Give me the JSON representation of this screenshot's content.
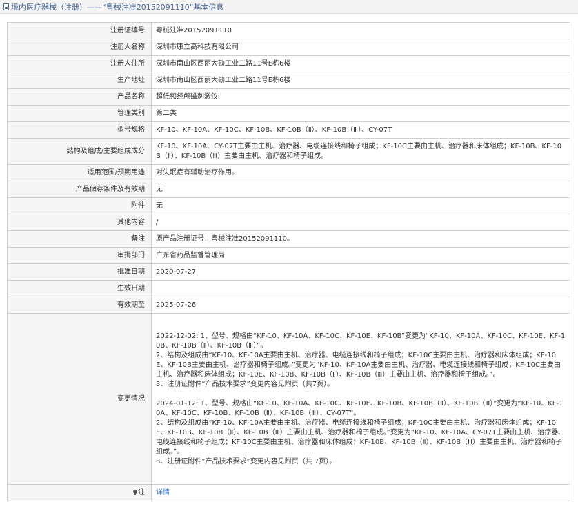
{
  "page": {
    "title": "境内医疗器械（注册）——“粤械注准20152091110”基本信息"
  },
  "rows": [
    {
      "label": "注册证编号",
      "value": "粤械注准20152091110"
    },
    {
      "label": "注册人名称",
      "value": "深圳市康立高科技有限公司"
    },
    {
      "label": "注册人住所",
      "value": "深圳市南山区西丽大勘工业二路11号E栋6楼"
    },
    {
      "label": "生产地址",
      "value": "深圳市南山区西丽大勘工业二路11号E栋6楼"
    },
    {
      "label": "产品名称",
      "value": "超低频经颅磁刺激仪"
    },
    {
      "label": "管理类别",
      "value": "第二类"
    },
    {
      "label": "型号规格",
      "value": "KF-10、KF-10A、KF-10C、KF-10B、KF-10B（Ⅱ）、KF-10B（Ⅲ）、CY-07T"
    },
    {
      "label": "结构及组成/主要组成成分",
      "value": "KF-10、KF-10A、CY-07T主要由主机、治疗器、电缆连接线和椅子组成；KF-10C主要由主机、治疗器和床体组成；KF-10B、KF-10B（Ⅱ）、KF-10B（Ⅲ）主要由主机、治疗器和椅子组成。"
    },
    {
      "label": "适用范围/预期用途",
      "value": "对失眠症有辅助治疗作用。"
    },
    {
      "label": "产品储存条件及有效期",
      "value": "无"
    },
    {
      "label": "附件",
      "value": "无"
    },
    {
      "label": "其他内容",
      "value": "/"
    },
    {
      "label": "备注",
      "value": "原产品注册证号：粤械注准20152091110。"
    },
    {
      "label": "审批部门",
      "value": "广东省药品监督管理局"
    },
    {
      "label": "批准日期",
      "value": "2020-07-27"
    },
    {
      "label": "生效日期",
      "value": ""
    },
    {
      "label": "有效期至",
      "value": "2025-07-26"
    }
  ],
  "changes": {
    "label": "变更情况",
    "block1": [
      "2022-12-02: 1、型号、规格由“KF-10、KF-10A、KF-10C、KF-10E、KF-10B”变更为“KF-10、KF-10A、KF-10C、KF-10E、KF-10B、KF-10B（Ⅱ）、KF-10B（Ⅲ）”。",
      "2、结构及组成由“KF-10、KF-10A主要由主机、治疗器、电缆连接线和椅子组成；KF-10C主要由主机、治疗器和床体组成；KF-10E、KF-10B主要由主机、治疗器和椅子组成。”变更为“KF-10、KF-10A主要由主机、治疗器、电缆连接线和椅子组成；KF-10C主要由主机、治疗器和床体组成；KF-10E、KF-10B、KF-10B（Ⅱ）、KF-10B（Ⅲ）主要由主机、治疗器和椅子组成。”。",
      "3、注册证附件“产品技术要求”变更内容见附页（共7页）。"
    ],
    "block2": [
      "2024-01-12: 1、型号、规格由“KF-10、KF-10A、KF-10C、KF-10E、KF-10B、KF-10B（Ⅱ）、KF-10B（Ⅲ）”变更为“KF-10、KF-10A、KF-10C、KF-10B、KF-10B（Ⅱ）、KF-10B（Ⅲ）、CY-07T”。",
      "2、结构及组成由“KF-10、KF-10A主要由主机、治疗器、电缆连接线和椅子组成；KF-10C主要由主机、治疗器和床体组成；KF-10E、KF-10B、KF-10B（Ⅱ）、KF-10B（Ⅲ）主要由主机、治疗器和椅子组成。”变更为“KF-10、KF-10A、CY-07T主要由主机、治疗器、电缆连接线和椅子组成；KF-10C主要由主机、治疗器和床体组成；KF-10B、KF-10B（Ⅱ）、KF-10B（Ⅲ）主要由主机、治疗器和椅子组成。”。",
      "3、注册证附件“产品技术要求”变更内容见附页（共 7页）。"
    ]
  },
  "note": {
    "label": "注",
    "link": "详情"
  }
}
